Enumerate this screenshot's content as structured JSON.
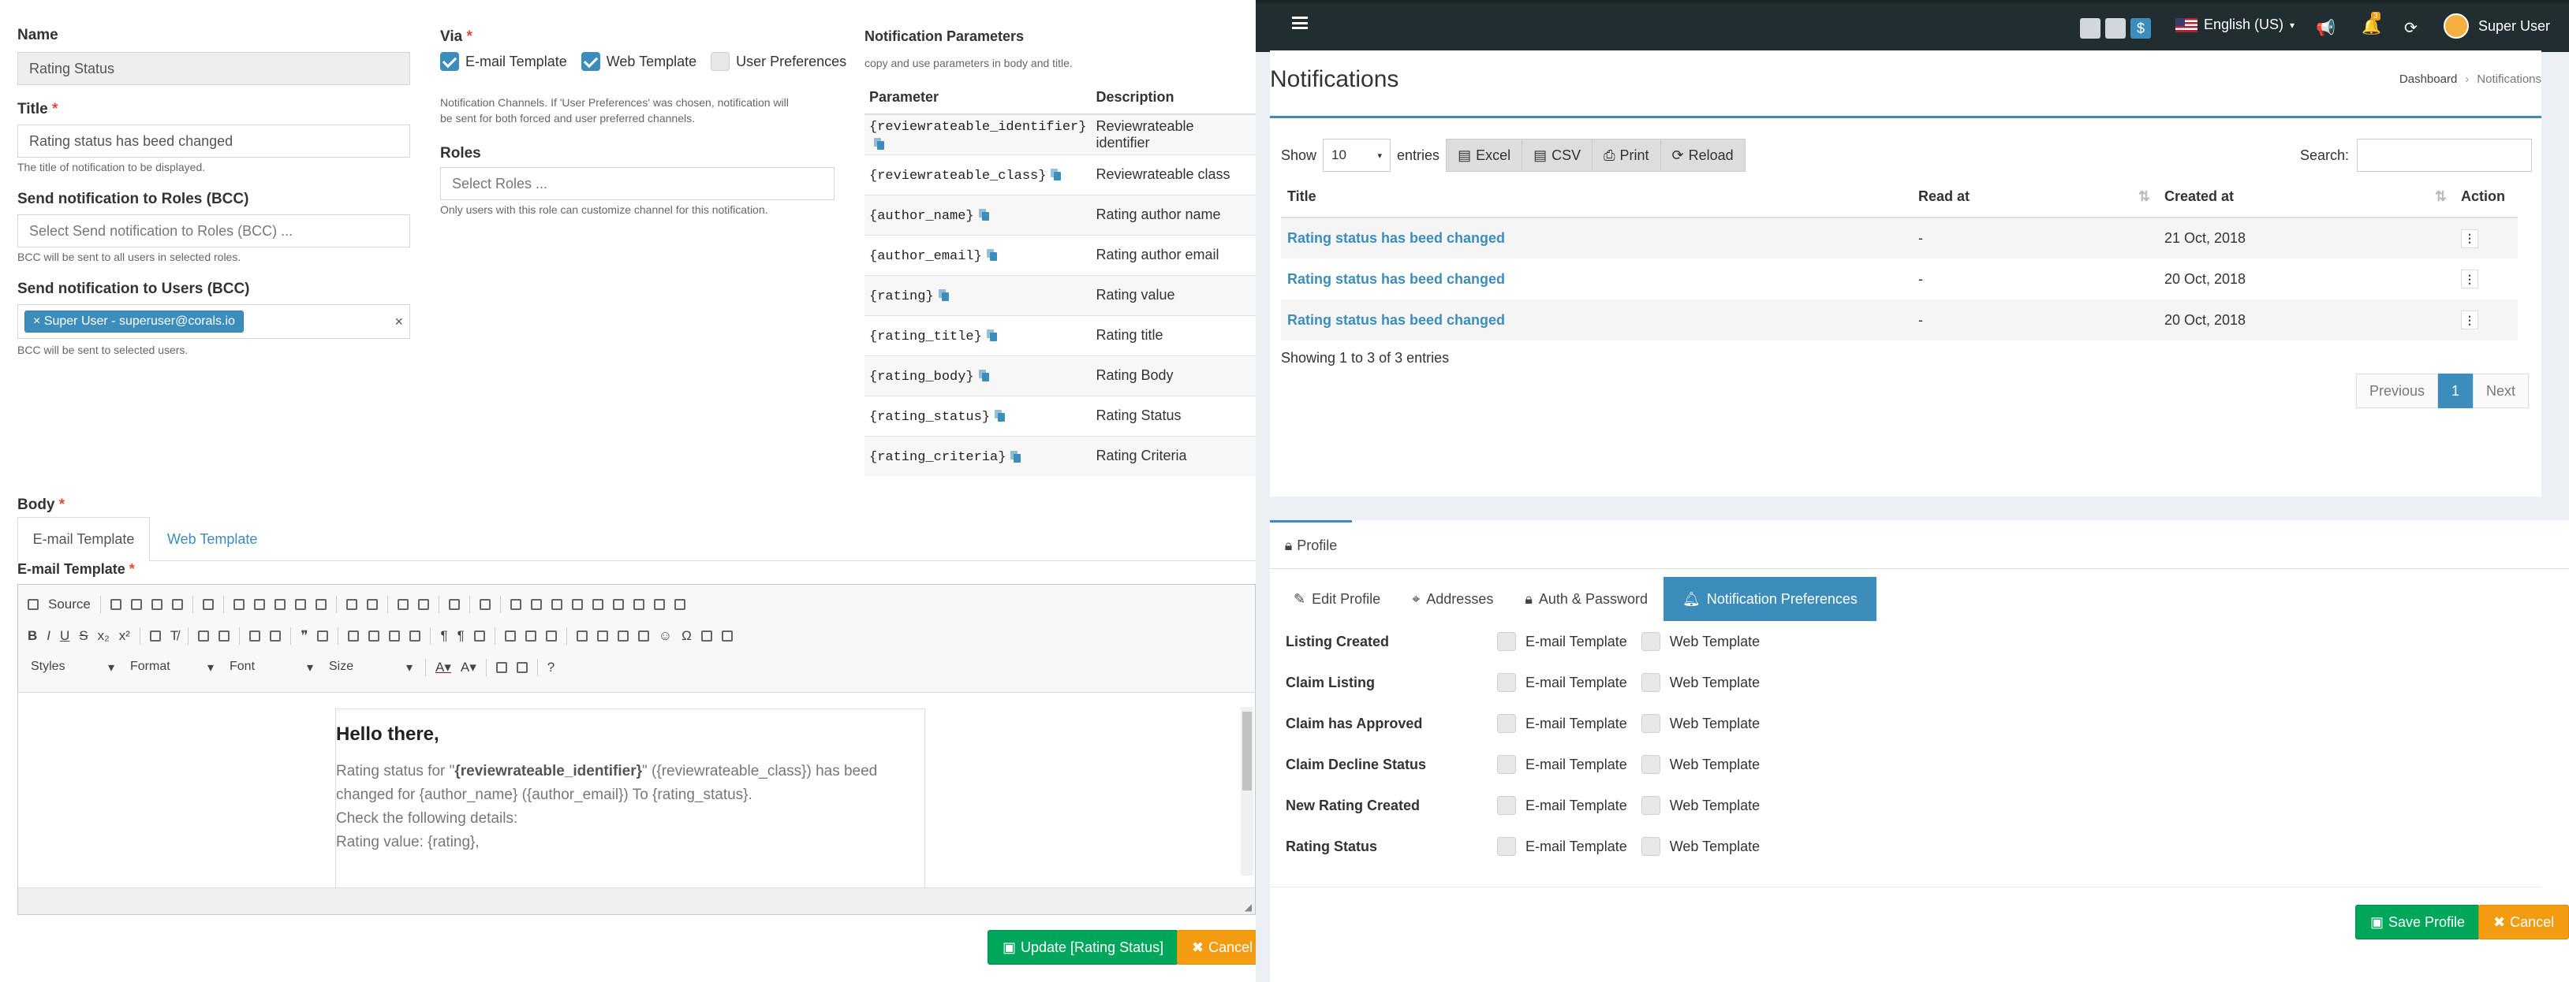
{
  "left": {
    "name": {
      "label": "Name",
      "value": "Rating Status"
    },
    "title_field": {
      "label": "Title",
      "value": "Rating status has beed changed",
      "help": "The title of notification to be displayed."
    },
    "roles_bcc": {
      "label": "Send notification to Roles (BCC)",
      "placeholder": "Select Send notification to Roles (BCC) ...",
      "help": "BCC will be sent to all users in selected roles."
    },
    "users_bcc": {
      "label": "Send notification to Users (BCC)",
      "tag": "Super User - superuser@corals.io",
      "help": "BCC will be sent to selected users."
    },
    "via": {
      "label": "Via",
      "options": [
        {
          "label": "E-mail Template",
          "checked": true
        },
        {
          "label": "Web Template",
          "checked": true
        },
        {
          "label": "User Preferences",
          "checked": false
        }
      ],
      "help1": "Notification Channels. If 'User Preferences' was chosen, notification will",
      "help2": "be sent for both forced and user preferred channels."
    },
    "roles": {
      "label": "Roles",
      "placeholder": "Select Roles ...",
      "help": "Only users with this role can customize channel for this notification."
    },
    "params": {
      "label": "Notification Parameters",
      "help": "copy and use parameters in body and title.",
      "headers": [
        "Parameter",
        "Description"
      ],
      "rows": [
        {
          "param": "{reviewrateable_identifier}",
          "desc": "Reviewrateable identifier"
        },
        {
          "param": "{reviewrateable_class}",
          "desc": "Reviewrateable class"
        },
        {
          "param": "{author_name}",
          "desc": "Rating author name"
        },
        {
          "param": "{author_email}",
          "desc": "Rating author email"
        },
        {
          "param": "{rating}",
          "desc": "Rating value"
        },
        {
          "param": "{rating_title}",
          "desc": "Rating title"
        },
        {
          "param": "{rating_body}",
          "desc": "Rating Body"
        },
        {
          "param": "{rating_status}",
          "desc": "Rating Status"
        },
        {
          "param": "{rating_criteria}",
          "desc": "Rating Criteria"
        }
      ]
    },
    "body": {
      "label": "Body",
      "tabs": [
        "E-mail Template",
        "Web Template"
      ],
      "editor_label": "E-mail Template",
      "toolbar": {
        "source": "Source",
        "styles": "Styles",
        "format": "Format",
        "font": "Font",
        "size": "Size"
      },
      "content": {
        "heading": "Hello there,",
        "line1_pre": "Rating status for \"",
        "line1_bold": "{reviewrateable_identifier}",
        "line1_post": "\" ({reviewrateable_class}) has beed",
        "line2": "changed for {author_name} ({author_email}) To {rating_status}.",
        "line3": "Check the following details:",
        "line4": "Rating value: {rating},"
      }
    },
    "update_button": "Update [Rating Status]",
    "cancel_button": "Cancel"
  },
  "right": {
    "topbar": {
      "language": "English (US)",
      "user": "Super User",
      "notif_count": "3"
    },
    "notifications": {
      "title": "Notifications",
      "breadcrumb": [
        "Dashboard",
        "Notifications"
      ],
      "show": "Show",
      "entries_value": "10",
      "entries": "entries",
      "buttons": [
        "Excel",
        "CSV",
        "Print",
        "Reload"
      ],
      "search_label": "Search:",
      "headers": [
        "Title",
        "Read at",
        "Created at",
        "Action"
      ],
      "rows": [
        {
          "title": "Rating status has beed changed",
          "read_at": "-",
          "created_at": "21 Oct, 2018"
        },
        {
          "title": "Rating status has beed changed",
          "read_at": "-",
          "created_at": "20 Oct, 2018"
        },
        {
          "title": "Rating status has beed changed",
          "read_at": "-",
          "created_at": "20 Oct, 2018"
        }
      ],
      "info": "Showing 1 to 3 of 3 entries",
      "pager": [
        "Previous",
        "1",
        "Next"
      ]
    },
    "profile": {
      "tab": "Profile",
      "subtabs": [
        "Edit Profile",
        "Addresses",
        "Auth & Password",
        "Notification Preferences"
      ],
      "pref_rows": [
        {
          "name": "Listing Created",
          "email": "E-mail Template",
          "web": "Web Template"
        },
        {
          "name": "Claim Listing",
          "email": "E-mail Template",
          "web": "Web Template"
        },
        {
          "name": "Claim has Approved",
          "email": "E-mail Template",
          "web": "Web Template"
        },
        {
          "name": "Claim Decline Status",
          "email": "E-mail Template",
          "web": "Web Template"
        },
        {
          "name": "New Rating Created",
          "email": "E-mail Template",
          "web": "Web Template"
        },
        {
          "name": "Rating Status",
          "email": "E-mail Template",
          "web": "Web Template"
        }
      ],
      "save_button": "Save Profile",
      "cancel_button": "Cancel"
    }
  }
}
